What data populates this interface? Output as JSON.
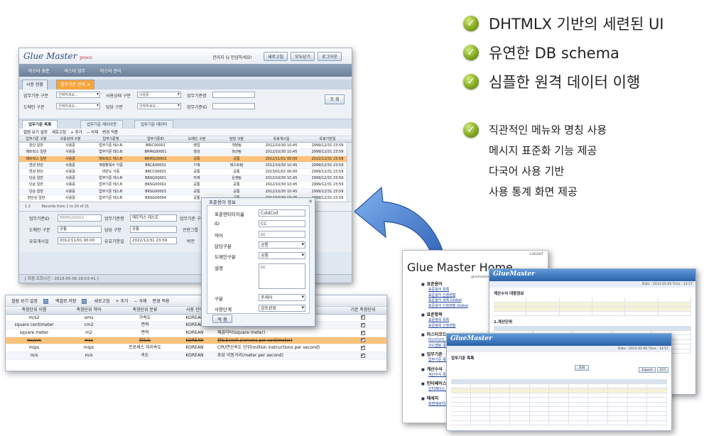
{
  "features": {
    "big": [
      "DHTMLX 기반의 세련된 UI",
      "유연한 DB schema",
      "심플한 원격 데이터 이행"
    ],
    "small_first": "직관적인 메뉴와 명칭 사용",
    "small_rest": [
      "메시지 표준화 기능 제공",
      "다국어 사용 기반",
      "사용 통계 화면 제공"
    ],
    "check_glyph": "✓"
  },
  "main_window": {
    "logo": "Glue Master",
    "logo_small": "posco",
    "user_greeting": "관리자 님 안녕하세요!",
    "buttons": [
      "새로고침",
      "모두닫기",
      "로그아웃"
    ],
    "menu": [
      "마스터 표준",
      "마스터 업무",
      "마스터 관리"
    ],
    "tabs": [
      "사용 현황",
      "업무기준 관리"
    ],
    "tab_close": "×",
    "search": {
      "labels": [
        "업무기준 구분",
        "사용상태 구분",
        "업무기준명",
        "도메인 구분",
        "담당 구분",
        "업무기준ID"
      ],
      "select_values": [
        "선택하세요...",
        "사용중",
        "선택하세요...",
        "선택하세요..."
      ],
      "go": "조 회"
    },
    "grid_tabs": [
      "업무기준 목록",
      "업무기준 레이아웃",
      "업무기준 데이터"
    ],
    "toolbar": [
      "컬럼 보기 설정",
      "새로고침",
      "+ 추가",
      "− 삭제",
      "변경 적용"
    ],
    "columns": [
      "업무기준 구분",
      "사용상태 구분",
      "업무기준명",
      "업무기준ID",
      "도메인 구분",
      "담당 구분",
      "유효개시일",
      "유효기한일"
    ],
    "rows": [
      [
        "판단 일반",
        "사용중",
        "업무기준 테스트",
        "BRIC00001",
        "영업",
        "개발팀",
        "2012/10/30 10:45",
        "2999/12/31 23:59"
      ],
      [
        "매트릭스 일반",
        "사용중",
        "업무기준 테스트",
        "BRMG00001",
        "철강",
        "생산팀",
        "2012/10/30 10:45",
        "2999/12/31 23:59"
      ],
      [
        "매트릭스 일반",
        "사용중",
        "매트릭스 테스트",
        "BRMG00002",
        "공통",
        "공통",
        "2012/11/01 00:00",
        "2022/12/31 23:59"
      ],
      [
        "연관 판단",
        "사용중",
        "계정항목수 가중",
        "BRCA00001",
        "기계",
        "테스트팀",
        "2012/10/30 10:45",
        "2999/12/31 23:59"
      ],
      [
        "연관 판단",
        "사용중",
        "비만도 가중",
        "BRCC00002",
        "공통",
        "공통",
        "2013/01/01 00:00",
        "2999/12/31 23:59"
      ],
      [
        "단순 일반",
        "사용중",
        "업무기준 테스트",
        "BRSG00001",
        "자재",
        "운영팀",
        "2012/10/30 10:45",
        "2999/12/31 23:59"
      ],
      [
        "단순 일반",
        "사용중",
        "업무기준 테스트",
        "BRSG00002",
        "공통",
        "공통",
        "2012/10/30 10:45",
        "2999/12/31 23:59"
      ],
      [
        "단순 일반",
        "사용중",
        "업무기준 테스트",
        "BRSG00003",
        "공통",
        "공통",
        "2012/10/30 10:45",
        "2999/12/31 23:59"
      ],
      [
        "판단상 일반",
        "사용중",
        "업무기준 테스트",
        "BRSG00004",
        "공통",
        "공통",
        "2012/10/30 10:45",
        "2999/12/31 23:59"
      ]
    ],
    "pager_pages": [
      "1",
      "2"
    ],
    "pager_text": "Records from 1 to 20 of 21",
    "detail": {
      "labels": [
        "업무기준ID",
        "업무기준명",
        "업무기준 구분",
        "도메인 구분",
        "담당 구분",
        "관련그룹",
        "유효개시일",
        "유효기한일",
        "버전"
      ],
      "values": [
        "BRMG00002",
        "매트릭스 테스트",
        "공통",
        "공통",
        "2012/11/01 00:00",
        "2022/12/31 23:59"
      ]
    },
    "status": "[ 최종 조회시간 : 2013-05-06 16:53:41 ]"
  },
  "popup": {
    "title": "표준용어 정보",
    "close": "✕",
    "fields": [
      {
        "label": "표준엔티티이름",
        "value": "ColdCoil"
      },
      {
        "label": "ID",
        "value": "CC"
      },
      {
        "label": "약어",
        "value": "cc"
      },
      {
        "label": "담당구분",
        "value": "공통"
      },
      {
        "label": "도메인구분",
        "value": "공통"
      },
      {
        "label": "설명",
        "value": "cc"
      },
      {
        "label": "구분",
        "value": "주제어"
      },
      {
        "label": "사용단계",
        "value": "검토완료"
      }
    ],
    "apply": "적 용"
  },
  "unit_window": {
    "toolbar": [
      "컬럼 보기 설정",
      "엑셀로 저장",
      "새로고침",
      "+ 추가",
      "− 삭제",
      "변경 적용"
    ],
    "columns": [
      "측정단위 이름",
      "측정단위 약어",
      "측정단위 분류",
      "사용 언어",
      "측정단위 설명",
      "기본 측정단위"
    ],
    "rows": [
      [
        "m/s2",
        "ams",
        "가속도",
        "KOREAN",
        "",
        ""
      ],
      [
        "square centimeter",
        "cm2",
        "면적",
        "KOREAN",
        "제곱센티미터(square centimeter)",
        ""
      ],
      [
        "square meter",
        "m2",
        "면적",
        "KOREAN",
        "제곱미터(square meter)",
        ""
      ],
      [
        "ms/cm",
        "msc",
        "전도도",
        "KOREAN",
        "전도도(mili siemens per centimeter)",
        ""
      ],
      [
        "mips",
        "mips",
        "프로세스 처리속도",
        "KOREAN",
        "CPU연산속도 단위(million instructions per second)",
        ""
      ],
      [
        "m/s",
        "m/s",
        "속도",
        "KOREAN",
        "초당 이동거리(meter per second)",
        ""
      ]
    ]
  },
  "home_window": {
    "logout": "LOGOUT",
    "title": "Glue Master Home",
    "greeting": "gluemaster 님 안녕하세요!",
    "sections": [
      {
        "title": "표준용어",
        "links": [
          "표준용어 목록",
          "표준용어 신청현황",
          "표준용어 목록 Global",
          "표준용어 신청현황 Global"
        ]
      },
      {
        "title": "표준항목",
        "links": [
          "표준항목 목록",
          "표준항목 신청현황"
        ]
      },
      {
        "title": "마스터코드",
        "links": [
          "마스터코드 목록",
          "코드맵핑 목록"
        ]
      },
      {
        "title": "업무기준",
        "links": [
          "업무기준 목록"
        ]
      },
      {
        "title": "계산수식",
        "links": [
          "계산수식 목록"
        ]
      },
      {
        "title": "인터페이스",
        "links": [
          "인터페이스 전송 목록"
        ]
      },
      {
        "title": "메세지",
        "links": [
          "화면메세지코드 목록"
        ]
      }
    ]
  },
  "calc_window": {
    "logo": "GlueMaster",
    "date": "Date : 2013-05-06  Time : 14:57",
    "title": "계산수식 대응정보",
    "sec2": "1.계산단위"
  },
  "list_window": {
    "logo": "GlueMaster",
    "date": "Date : 2013-05-06  Time : 14:57",
    "title": "업무기준 목록",
    "buttons": [
      "조회",
      "Export",
      "닫기"
    ]
  },
  "colors": {
    "accent_orange": "#f7a43b",
    "highlight_row": "#fbc27a",
    "arrow_blue": "#3d6fc1",
    "check_green": "#7ea51c"
  }
}
